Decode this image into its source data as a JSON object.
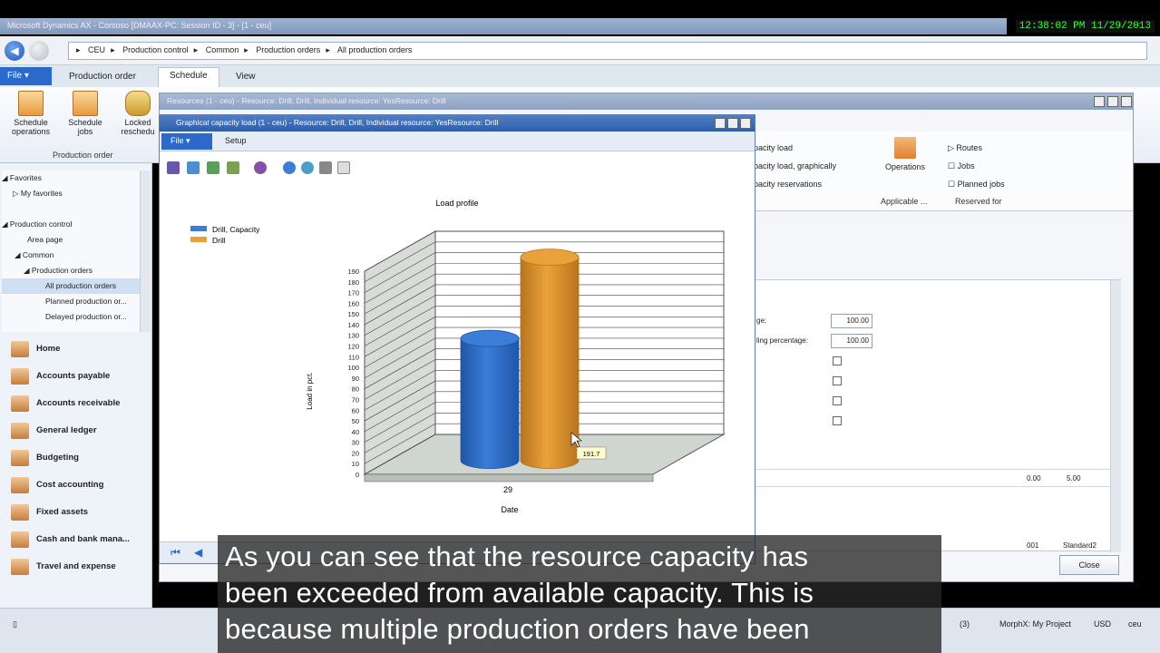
{
  "app": {
    "title": "Microsoft Dynamics AX - Contoso [DMAAX-PC: Session ID - 3] - [1 - ceu]",
    "clock": "12:38:02 PM 11/29/2013"
  },
  "breadcrumb": [
    "CEU",
    "Production control",
    "Common",
    "Production orders",
    "All production orders"
  ],
  "ribbon": {
    "file_label": "File",
    "tabs": [
      "Production order",
      "Schedule",
      "View"
    ],
    "buttons": [
      {
        "label": "Schedule operations"
      },
      {
        "label": "Schedule jobs"
      },
      {
        "label": "Locked reschedu"
      }
    ],
    "group_label": "Production order"
  },
  "navpane": {
    "favorites": "Favorites",
    "my_favorites": "My favorites",
    "tree": [
      "Production control",
      "Area page",
      "Common",
      "Production orders",
      "All production orders",
      "Planned production or...",
      "Delayed production or..."
    ],
    "modules": [
      "Home",
      "Accounts payable",
      "Accounts receivable",
      "General ledger",
      "Budgeting",
      "Cost accounting",
      "Fixed assets",
      "Cash and bank mana...",
      "Travel and expense"
    ]
  },
  "bg_window": {
    "title": "Resources (1 - ceu) - Resource: Drill, Drill, Individual resource: YesResource: Drill",
    "links": [
      "pacity load",
      "pacity load, graphically",
      "pacity reservations"
    ],
    "operations": "Operations",
    "applicable": "Applicable ...",
    "reserved": [
      "Routes",
      "Jobs",
      "Planned jobs"
    ],
    "reserved_label": "Reserved for",
    "field_labels": [
      "ge:",
      "ling percentage:"
    ],
    "field_values": [
      "100.00",
      "100.00"
    ],
    "grid_values": [
      "0.00",
      "5.00"
    ],
    "grid_row2": [
      "001",
      "Standard2"
    ],
    "close": "Close"
  },
  "fg_window": {
    "title": "Graphical capacity load (1 - ceu) - Resource: Drill, Drill, Individual resource: YesResource: Drill",
    "file_label": "File",
    "menu": [
      "Setup"
    ]
  },
  "chart_data": {
    "type": "bar",
    "title": "Load profile",
    "xlabel": "Date",
    "ylabel": "Load in pct.",
    "categories": [
      "29"
    ],
    "series": [
      {
        "name": "Drill, Capacity",
        "values": [
          114
        ],
        "color": "#3a7ed8"
      },
      {
        "name": "Drill",
        "values": [
          190
        ],
        "color": "#e9a23a"
      }
    ],
    "ylim": [
      0,
      190
    ],
    "yticks": [
      0,
      10,
      20,
      30,
      40,
      50,
      60,
      70,
      80,
      90,
      100,
      110,
      120,
      130,
      140,
      150,
      160,
      170,
      180,
      190
    ],
    "tooltip": "191.7",
    "legend": "top-left",
    "grid": true
  },
  "status": {
    "items": [
      "(3)",
      "MorphX: My Project",
      "USD",
      "ceu"
    ]
  },
  "caption": {
    "lines": [
      "As you can see that the resource capacity has",
      "been exceeded from available capacity. This is",
      "because multiple production orders have been"
    ]
  },
  "colors": {
    "accent": "#2b6acb",
    "capacity": "#3a7ed8",
    "drill": "#e9a23a"
  }
}
